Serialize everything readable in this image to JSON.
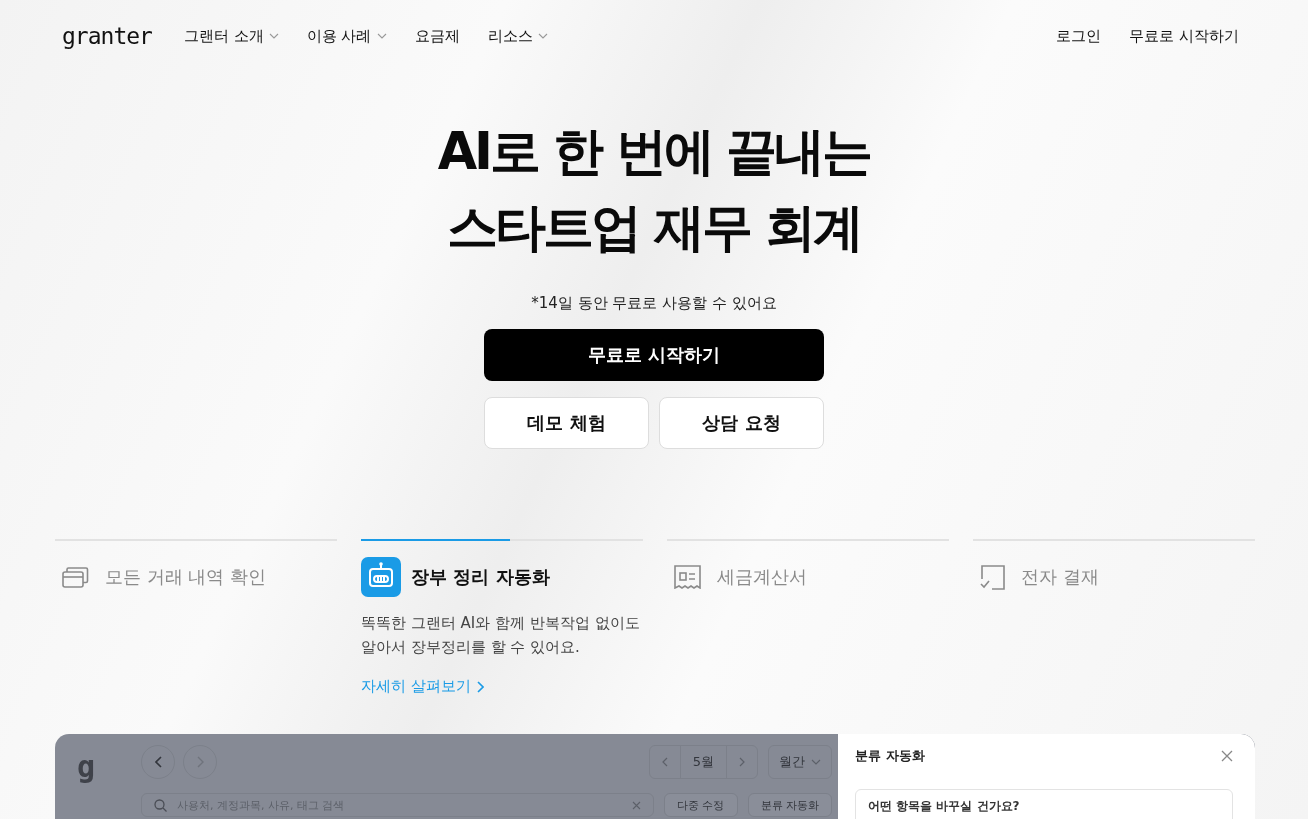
{
  "nav": {
    "logo": "granter",
    "menu": [
      {
        "label": "그랜터 소개",
        "dropdown": true
      },
      {
        "label": "이용 사례",
        "dropdown": true
      },
      {
        "label": "요금제",
        "dropdown": false
      },
      {
        "label": "리소스",
        "dropdown": true
      }
    ],
    "actions": [
      "로그인",
      "무료로 시작하기"
    ]
  },
  "hero": {
    "title_lines": [
      "AI로 한 번에 끝내는",
      "스타트업 재무 회계"
    ],
    "note": "*14일 동안 무료로 사용할 수 있어요",
    "primary_button": "무료로 시작하기",
    "secondary_buttons": [
      "데모 체험",
      "상담 요청"
    ]
  },
  "features": [
    {
      "kind": "cards",
      "label": "모든 거래 내역 확인",
      "selected": false
    },
    {
      "kind": "robot",
      "label": "장부 정리 자동화",
      "selected": true,
      "level": 0.53,
      "description": "똑똑한 그랜터 AI와 함께 반복작업 없이도\n알아서 장부정리를 할 수 있어요.",
      "link": "자세히 살펴보기"
    },
    {
      "kind": "receipt",
      "label": "세금계산서",
      "selected": false
    },
    {
      "kind": "sign",
      "label": "전자 결재",
      "selected": false
    }
  ],
  "preview": {
    "logo": "g",
    "month": "5월",
    "period": "월간",
    "search_placeholder": "사용처, 계정과목, 사유, 태그 검색",
    "buttons": [
      "다중 수정",
      "분류 자동화"
    ],
    "panel": {
      "title": "분류 자동화",
      "question": "어떤 항목을 바꾸실 건가요?"
    }
  }
}
